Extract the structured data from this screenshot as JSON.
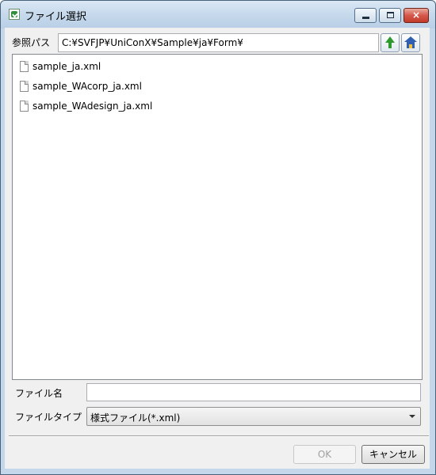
{
  "window": {
    "title": "ファイル選択",
    "controls": {
      "minimize": "minimize",
      "maximize": "maximize",
      "close": "×"
    }
  },
  "path": {
    "label": "参照パス",
    "value": "C:¥SVFJP¥UniConX¥Sample¥ja¥Form¥",
    "up_icon": "up-arrow-icon",
    "home_icon": "home-icon"
  },
  "files": [
    {
      "name": "sample_ja.xml",
      "icon": "file-icon"
    },
    {
      "name": "sample_WAcorp_ja.xml",
      "icon": "file-icon"
    },
    {
      "name": "sample_WAdesign_ja.xml",
      "icon": "file-icon"
    }
  ],
  "filename": {
    "label": "ファイル名",
    "value": ""
  },
  "filetype": {
    "label": "ファイルタイプ",
    "selected": "様式ファイル(*.xml)"
  },
  "buttons": {
    "ok": "OK",
    "cancel": "キャンセル",
    "ok_enabled": false
  },
  "colors": {
    "titlebar": "#c6d9ec",
    "close_button": "#d5584a",
    "up_arrow": "#2e9a2e",
    "home": "#2e5fb2"
  }
}
